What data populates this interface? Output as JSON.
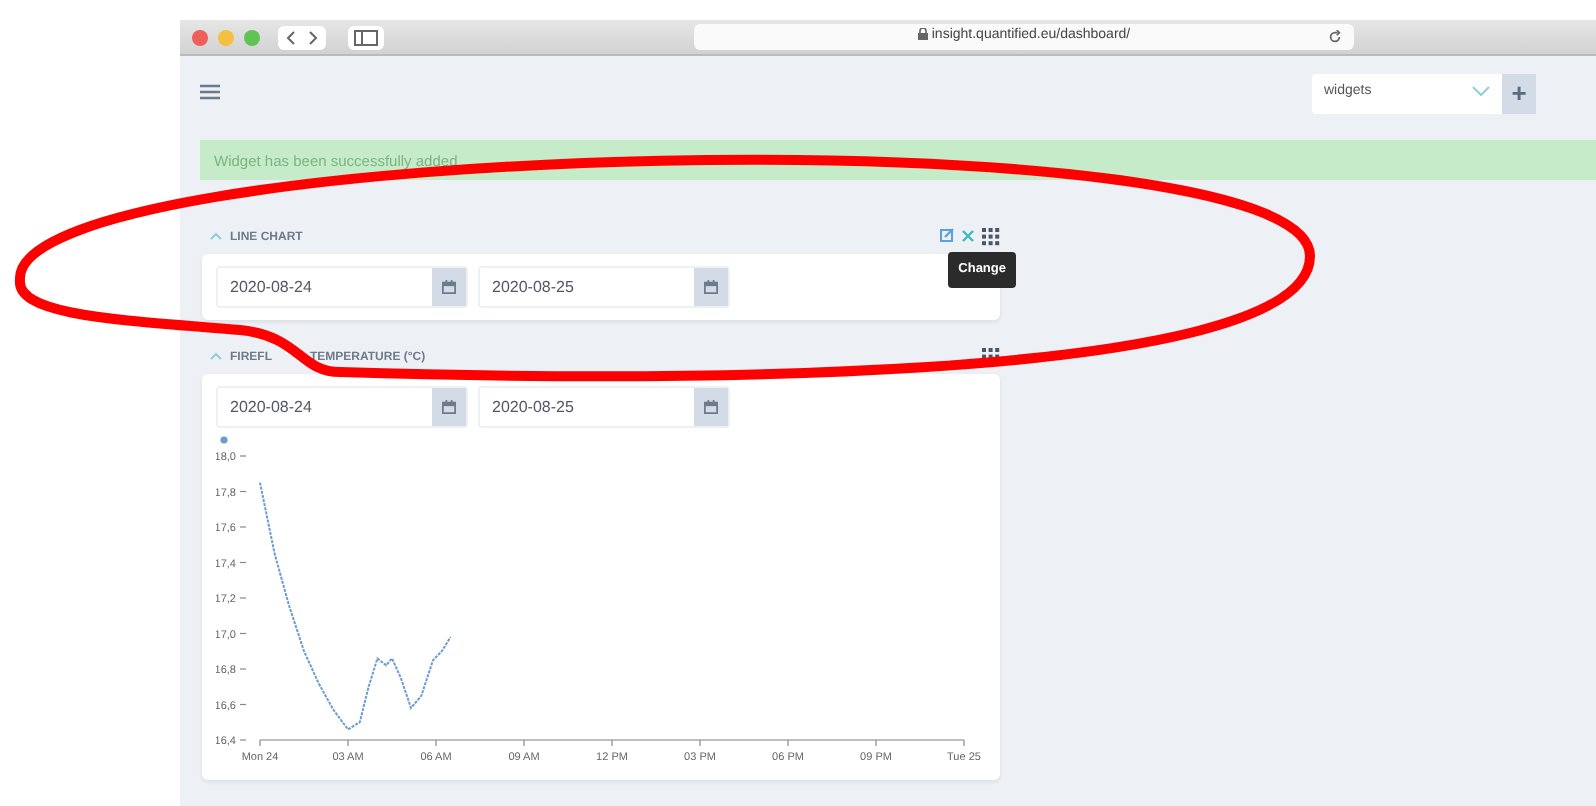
{
  "browser": {
    "url": "insight.quantified.eu/dashboard/"
  },
  "toolbar": {
    "select": {
      "value": "widgets"
    },
    "add_button": "+"
  },
  "alert": {
    "text": "Widget has been successfully added"
  },
  "widgets": [
    {
      "kind": "empty",
      "title": "LINE CHART",
      "expanded": true,
      "actions": true,
      "tooltip": "Change",
      "from": "2020-08-24",
      "to": "2020-08-25"
    },
    {
      "kind": "chart",
      "title": "FIREFL",
      "title_tail": "TEMPERATURE (°C)",
      "expanded": true,
      "actions": false,
      "from": "2020-08-24",
      "to": "2020-08-25",
      "chart_data": {
        "type": "line",
        "x": [
          "2020-08-24T00:00",
          "2020-08-24T00:30",
          "2020-08-24T01:00",
          "2020-08-24T01:30",
          "2020-08-24T02:00",
          "2020-08-24T02:30",
          "2020-08-24T03:00",
          "2020-08-24T03:24",
          "2020-08-24T03:42",
          "2020-08-24T04:00",
          "2020-08-24T04:18",
          "2020-08-24T04:30",
          "2020-08-24T04:48",
          "2020-08-24T05:09",
          "2020-08-24T05:30",
          "2020-08-24T05:54",
          "2020-08-24T06:12",
          "2020-08-24T06:30"
        ],
        "series": [
          {
            "color": "#6b9bd1",
            "line_style": "dotted",
            "values": [
              17.85,
              17.45,
              17.15,
              16.9,
              16.72,
              16.57,
              16.46,
              16.5,
              16.7,
              16.86,
              16.82,
              16.86,
              16.75,
              16.58,
              16.65,
              16.85,
              16.9,
              16.98
            ]
          }
        ],
        "xlim": [
          "2020-08-24T00:00",
          "2020-08-25T00:00"
        ],
        "ylim": [
          16.4,
          18.0
        ],
        "xticks": [
          {
            "value": "2020-08-24T00:00",
            "label": "Mon 24"
          },
          {
            "value": "2020-08-24T03:00",
            "label": "03 AM"
          },
          {
            "value": "2020-08-24T06:00",
            "label": "06 AM"
          },
          {
            "value": "2020-08-24T09:00",
            "label": "09 AM"
          },
          {
            "value": "2020-08-24T12:00",
            "label": "12 PM"
          },
          {
            "value": "2020-08-24T15:00",
            "label": "03 PM"
          },
          {
            "value": "2020-08-24T18:00",
            "label": "06 PM"
          },
          {
            "value": "2020-08-24T21:00",
            "label": "09 PM"
          },
          {
            "value": "2020-08-25T00:00",
            "label": "Tue 25"
          }
        ],
        "yticks": [
          {
            "value": 16.4,
            "label": "16,4"
          },
          {
            "value": 16.6,
            "label": "16,6"
          },
          {
            "value": 16.8,
            "label": "16,8"
          },
          {
            "value": 17.0,
            "label": "17,0"
          },
          {
            "value": 17.2,
            "label": "17,2"
          },
          {
            "value": 17.4,
            "label": "17,4"
          },
          {
            "value": 17.6,
            "label": "17,6"
          },
          {
            "value": 17.8,
            "label": "17,8"
          },
          {
            "value": 18.0,
            "label": "18,0"
          }
        ]
      }
    }
  ]
}
